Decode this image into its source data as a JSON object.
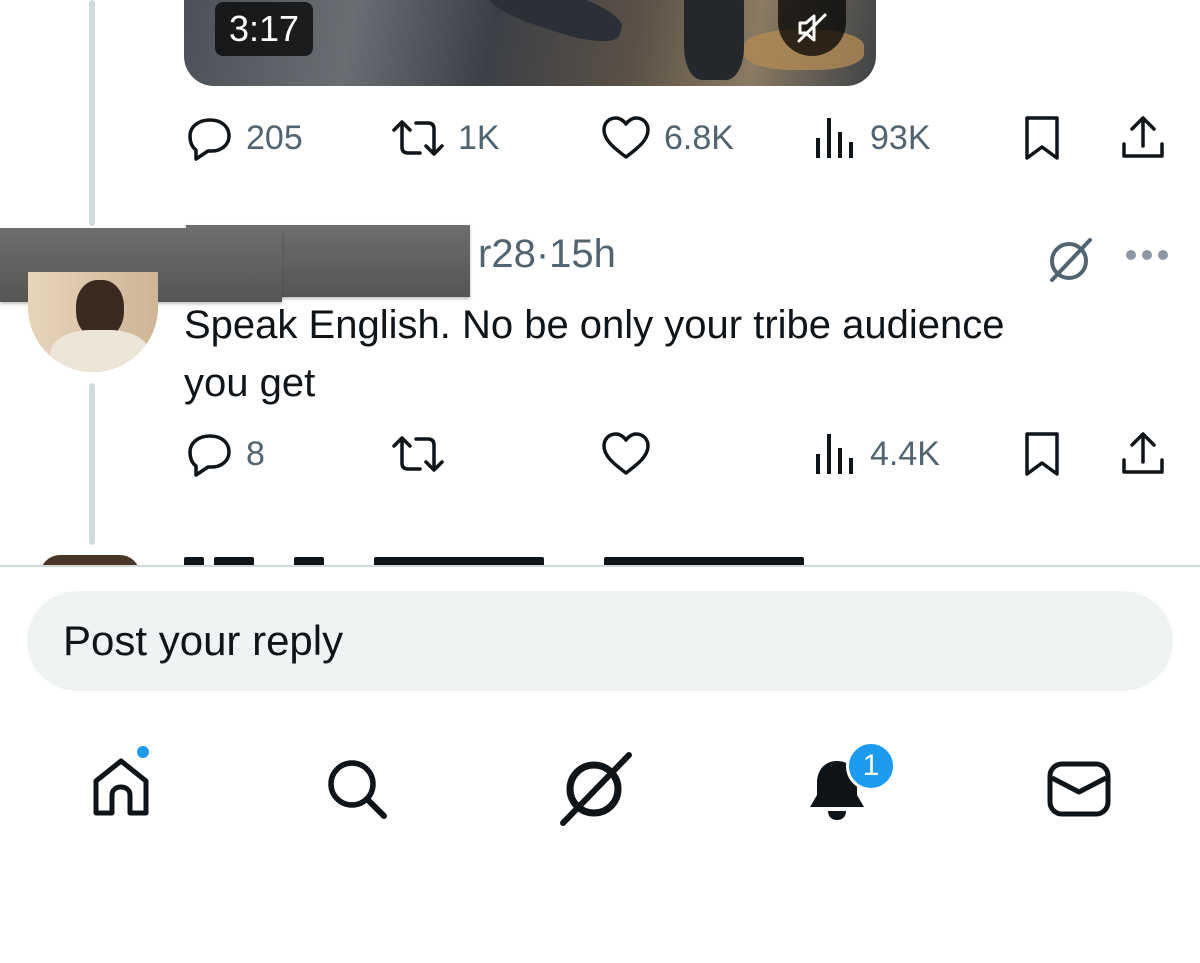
{
  "video": {
    "duration": "3:17",
    "mute_icon": "speaker-muted-icon"
  },
  "tweet1": {
    "actions": {
      "reply_count": "205",
      "retweet_count": "1K",
      "like_count": "6.8K",
      "view_count": "93K"
    }
  },
  "tweet2": {
    "handle_fragment": "r28",
    "separator": "·",
    "time": "15h",
    "text_line1": "Speak English.  No be only your tribe audience",
    "text_line2": "you get",
    "actions": {
      "reply_count": "8",
      "view_count": "4.4K"
    }
  },
  "reply_box": {
    "placeholder": "Post your reply"
  },
  "bottom_nav": {
    "notifications_badge": "1",
    "items": [
      "home-icon",
      "search-icon",
      "grok-icon",
      "notifications-icon",
      "messages-icon"
    ]
  },
  "colors": {
    "accent": "#1d9bf0",
    "muted_text": "#536471",
    "primary_text": "#0f1419",
    "thread_line": "#cfd9de"
  }
}
